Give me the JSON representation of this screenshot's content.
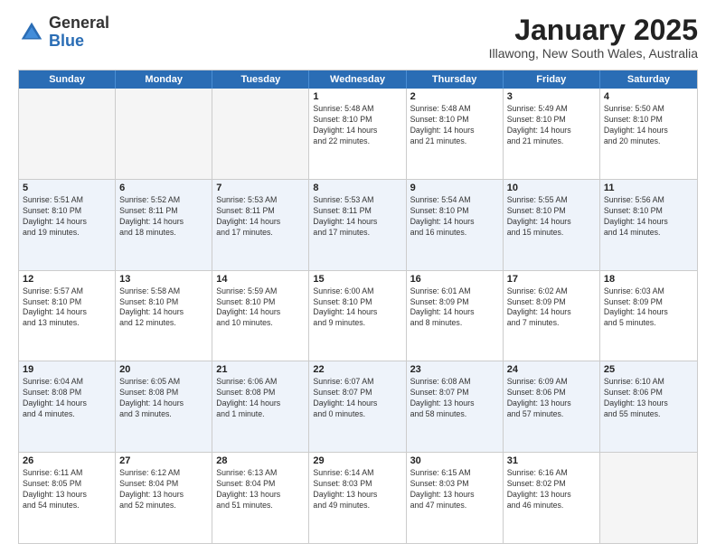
{
  "logo": {
    "general": "General",
    "blue": "Blue"
  },
  "title": "January 2025",
  "location": "Illawong, New South Wales, Australia",
  "header_days": [
    "Sunday",
    "Monday",
    "Tuesday",
    "Wednesday",
    "Thursday",
    "Friday",
    "Saturday"
  ],
  "rows": [
    [
      {
        "day": "",
        "info": "",
        "empty": true
      },
      {
        "day": "",
        "info": "",
        "empty": true
      },
      {
        "day": "",
        "info": "",
        "empty": true
      },
      {
        "day": "1",
        "info": "Sunrise: 5:48 AM\nSunset: 8:10 PM\nDaylight: 14 hours\nand 22 minutes.",
        "empty": false
      },
      {
        "day": "2",
        "info": "Sunrise: 5:48 AM\nSunset: 8:10 PM\nDaylight: 14 hours\nand 21 minutes.",
        "empty": false
      },
      {
        "day": "3",
        "info": "Sunrise: 5:49 AM\nSunset: 8:10 PM\nDaylight: 14 hours\nand 21 minutes.",
        "empty": false
      },
      {
        "day": "4",
        "info": "Sunrise: 5:50 AM\nSunset: 8:10 PM\nDaylight: 14 hours\nand 20 minutes.",
        "empty": false
      }
    ],
    [
      {
        "day": "5",
        "info": "Sunrise: 5:51 AM\nSunset: 8:10 PM\nDaylight: 14 hours\nand 19 minutes.",
        "empty": false
      },
      {
        "day": "6",
        "info": "Sunrise: 5:52 AM\nSunset: 8:11 PM\nDaylight: 14 hours\nand 18 minutes.",
        "empty": false
      },
      {
        "day": "7",
        "info": "Sunrise: 5:53 AM\nSunset: 8:11 PM\nDaylight: 14 hours\nand 17 minutes.",
        "empty": false
      },
      {
        "day": "8",
        "info": "Sunrise: 5:53 AM\nSunset: 8:11 PM\nDaylight: 14 hours\nand 17 minutes.",
        "empty": false
      },
      {
        "day": "9",
        "info": "Sunrise: 5:54 AM\nSunset: 8:10 PM\nDaylight: 14 hours\nand 16 minutes.",
        "empty": false
      },
      {
        "day": "10",
        "info": "Sunrise: 5:55 AM\nSunset: 8:10 PM\nDaylight: 14 hours\nand 15 minutes.",
        "empty": false
      },
      {
        "day": "11",
        "info": "Sunrise: 5:56 AM\nSunset: 8:10 PM\nDaylight: 14 hours\nand 14 minutes.",
        "empty": false
      }
    ],
    [
      {
        "day": "12",
        "info": "Sunrise: 5:57 AM\nSunset: 8:10 PM\nDaylight: 14 hours\nand 13 minutes.",
        "empty": false
      },
      {
        "day": "13",
        "info": "Sunrise: 5:58 AM\nSunset: 8:10 PM\nDaylight: 14 hours\nand 12 minutes.",
        "empty": false
      },
      {
        "day": "14",
        "info": "Sunrise: 5:59 AM\nSunset: 8:10 PM\nDaylight: 14 hours\nand 10 minutes.",
        "empty": false
      },
      {
        "day": "15",
        "info": "Sunrise: 6:00 AM\nSunset: 8:10 PM\nDaylight: 14 hours\nand 9 minutes.",
        "empty": false
      },
      {
        "day": "16",
        "info": "Sunrise: 6:01 AM\nSunset: 8:09 PM\nDaylight: 14 hours\nand 8 minutes.",
        "empty": false
      },
      {
        "day": "17",
        "info": "Sunrise: 6:02 AM\nSunset: 8:09 PM\nDaylight: 14 hours\nand 7 minutes.",
        "empty": false
      },
      {
        "day": "18",
        "info": "Sunrise: 6:03 AM\nSunset: 8:09 PM\nDaylight: 14 hours\nand 5 minutes.",
        "empty": false
      }
    ],
    [
      {
        "day": "19",
        "info": "Sunrise: 6:04 AM\nSunset: 8:08 PM\nDaylight: 14 hours\nand 4 minutes.",
        "empty": false
      },
      {
        "day": "20",
        "info": "Sunrise: 6:05 AM\nSunset: 8:08 PM\nDaylight: 14 hours\nand 3 minutes.",
        "empty": false
      },
      {
        "day": "21",
        "info": "Sunrise: 6:06 AM\nSunset: 8:08 PM\nDaylight: 14 hours\nand 1 minute.",
        "empty": false
      },
      {
        "day": "22",
        "info": "Sunrise: 6:07 AM\nSunset: 8:07 PM\nDaylight: 14 hours\nand 0 minutes.",
        "empty": false
      },
      {
        "day": "23",
        "info": "Sunrise: 6:08 AM\nSunset: 8:07 PM\nDaylight: 13 hours\nand 58 minutes.",
        "empty": false
      },
      {
        "day": "24",
        "info": "Sunrise: 6:09 AM\nSunset: 8:06 PM\nDaylight: 13 hours\nand 57 minutes.",
        "empty": false
      },
      {
        "day": "25",
        "info": "Sunrise: 6:10 AM\nSunset: 8:06 PM\nDaylight: 13 hours\nand 55 minutes.",
        "empty": false
      }
    ],
    [
      {
        "day": "26",
        "info": "Sunrise: 6:11 AM\nSunset: 8:05 PM\nDaylight: 13 hours\nand 54 minutes.",
        "empty": false
      },
      {
        "day": "27",
        "info": "Sunrise: 6:12 AM\nSunset: 8:04 PM\nDaylight: 13 hours\nand 52 minutes.",
        "empty": false
      },
      {
        "day": "28",
        "info": "Sunrise: 6:13 AM\nSunset: 8:04 PM\nDaylight: 13 hours\nand 51 minutes.",
        "empty": false
      },
      {
        "day": "29",
        "info": "Sunrise: 6:14 AM\nSunset: 8:03 PM\nDaylight: 13 hours\nand 49 minutes.",
        "empty": false
      },
      {
        "day": "30",
        "info": "Sunrise: 6:15 AM\nSunset: 8:03 PM\nDaylight: 13 hours\nand 47 minutes.",
        "empty": false
      },
      {
        "day": "31",
        "info": "Sunrise: 6:16 AM\nSunset: 8:02 PM\nDaylight: 13 hours\nand 46 minutes.",
        "empty": false
      },
      {
        "day": "",
        "info": "",
        "empty": true
      }
    ]
  ]
}
